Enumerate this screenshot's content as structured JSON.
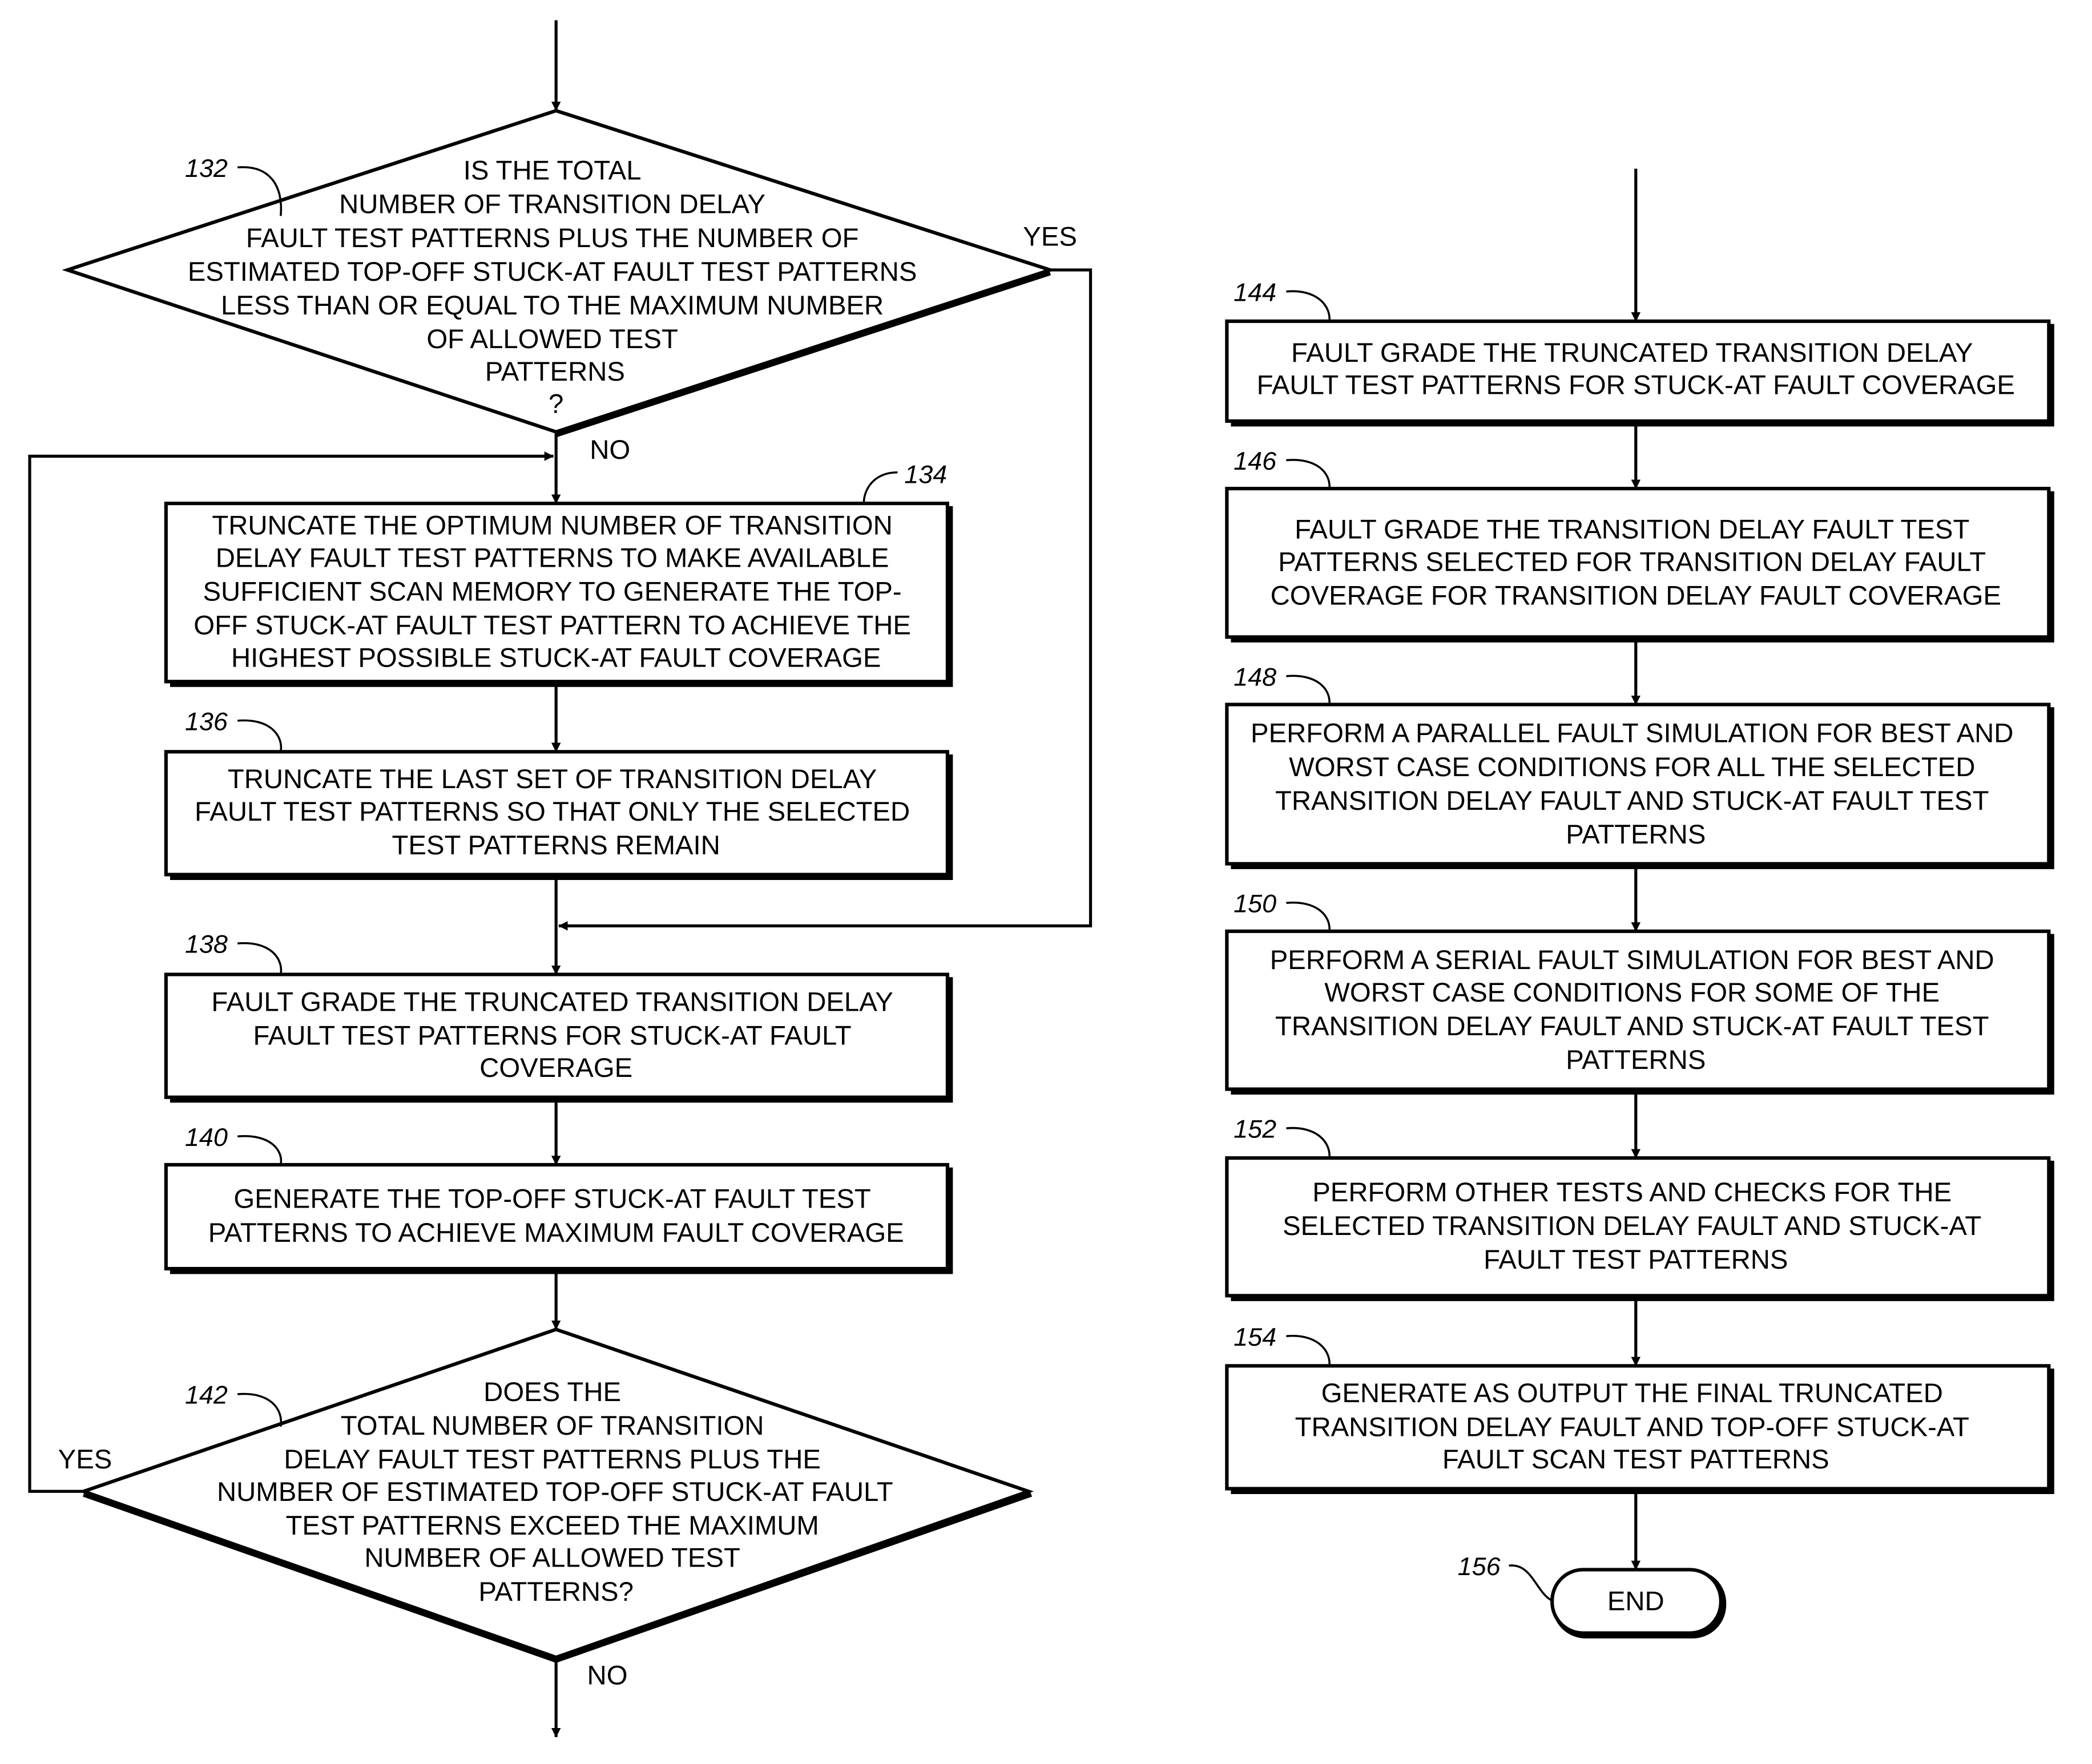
{
  "figure": {
    "left_column": {
      "decision_132": {
        "ref": "132",
        "lines": [
          "IS THE TOTAL",
          "NUMBER OF TRANSITION DELAY",
          "FAULT TEST PATTERNS PLUS THE NUMBER OF",
          "ESTIMATED TOP-OFF STUCK-AT FAULT TEST PATTERNS",
          "LESS THAN OR EQUAL TO THE MAXIMUM NUMBER",
          "OF ALLOWED TEST",
          "PATTERNS",
          "?"
        ],
        "yes_label": "YES",
        "no_label": "NO"
      },
      "step_134": {
        "ref": "134",
        "lines": [
          "TRUNCATE THE OPTIMUM NUMBER OF TRANSITION",
          "DELAY FAULT TEST PATTERNS TO MAKE AVAILABLE",
          "SUFFICIENT SCAN MEMORY TO GENERATE THE TOP-",
          "OFF STUCK-AT FAULT TEST PATTERN TO ACHIEVE THE",
          "HIGHEST POSSIBLE STUCK-AT FAULT COVERAGE"
        ]
      },
      "step_136": {
        "ref": "136",
        "lines": [
          "TRUNCATE THE LAST SET OF TRANSITION DELAY",
          "FAULT TEST PATTERNS SO THAT ONLY THE SELECTED",
          "TEST PATTERNS REMAIN"
        ]
      },
      "step_138": {
        "ref": "138",
        "lines": [
          "FAULT GRADE THE TRUNCATED TRANSITION DELAY",
          "FAULT TEST PATTERNS FOR STUCK-AT FAULT",
          "COVERAGE"
        ]
      },
      "step_140": {
        "ref": "140",
        "lines": [
          "GENERATE THE TOP-OFF STUCK-AT FAULT TEST",
          "PATTERNS TO ACHIEVE MAXIMUM FAULT COVERAGE"
        ]
      },
      "decision_142": {
        "ref": "142",
        "lines": [
          "DOES THE",
          "TOTAL NUMBER OF TRANSITION",
          "DELAY FAULT TEST PATTERNS PLUS THE",
          "NUMBER OF ESTIMATED TOP-OFF STUCK-AT FAULT",
          "TEST PATTERNS EXCEED THE MAXIMUM",
          "NUMBER OF ALLOWED TEST",
          "PATTERNS?"
        ],
        "yes_label": "YES",
        "no_label": "NO"
      }
    },
    "right_column": {
      "step_144": {
        "ref": "144",
        "lines": [
          "FAULT GRADE THE TRUNCATED TRANSITION DELAY",
          "FAULT TEST PATTERNS FOR STUCK-AT FAULT COVERAGE"
        ]
      },
      "step_146": {
        "ref": "146",
        "lines": [
          "FAULT GRADE THE TRANSITION DELAY FAULT TEST",
          "PATTERNS SELECTED FOR TRANSITION DELAY FAULT",
          "COVERAGE FOR TRANSITION DELAY FAULT COVERAGE"
        ]
      },
      "step_148": {
        "ref": "148",
        "lines": [
          "PERFORM A PARALLEL FAULT SIMULATION FOR BEST AND",
          "WORST CASE CONDITIONS FOR ALL THE SELECTED",
          "TRANSITION DELAY FAULT AND STUCK-AT FAULT TEST",
          "PATTERNS"
        ]
      },
      "step_150": {
        "ref": "150",
        "lines": [
          "PERFORM A SERIAL FAULT SIMULATION FOR BEST AND",
          "WORST CASE CONDITIONS FOR SOME OF THE",
          "TRANSITION DELAY FAULT AND STUCK-AT FAULT TEST",
          "PATTERNS"
        ]
      },
      "step_152": {
        "ref": "152",
        "lines": [
          "PERFORM OTHER TESTS AND CHECKS FOR THE",
          "SELECTED TRANSITION DELAY FAULT AND STUCK-AT",
          "FAULT TEST PATTERNS"
        ]
      },
      "step_154": {
        "ref": "154",
        "lines": [
          "GENERATE AS OUTPUT THE FINAL TRUNCATED",
          "TRANSITION DELAY FAULT AND TOP-OFF STUCK-AT",
          "FAULT SCAN TEST PATTERNS"
        ]
      },
      "end_156": {
        "ref": "156",
        "label": "END"
      }
    }
  }
}
